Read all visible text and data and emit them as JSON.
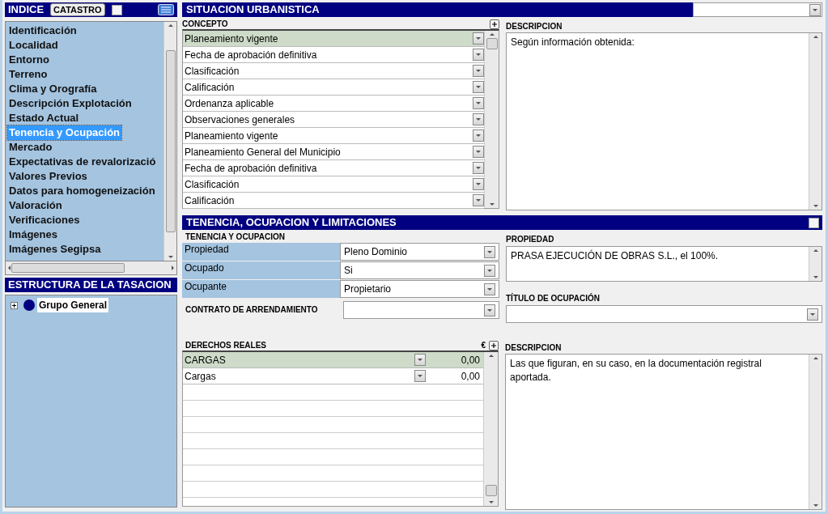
{
  "index": {
    "title": "INDICE",
    "catastro_button": "CATASTRO",
    "catastro_checked": false,
    "items": [
      {
        "label": "Identificación",
        "selected": false
      },
      {
        "label": "Localidad",
        "selected": false
      },
      {
        "label": "Entorno",
        "selected": false
      },
      {
        "label": "Terreno",
        "selected": false
      },
      {
        "label": "Clima y Orografía",
        "selected": false
      },
      {
        "label": "Descripción Explotación",
        "selected": false
      },
      {
        "label": "Estado Actual",
        "selected": false
      },
      {
        "label": "Tenencia y Ocupación",
        "selected": true
      },
      {
        "label": "Mercado",
        "selected": false
      },
      {
        "label": "Expectativas de revalorizació",
        "selected": false
      },
      {
        "label": "Valores Previos",
        "selected": false
      },
      {
        "label": "Datos para homogeneización",
        "selected": false
      },
      {
        "label": "Valoración",
        "selected": false
      },
      {
        "label": "Verificaciones",
        "selected": false
      },
      {
        "label": "Imágenes",
        "selected": false
      },
      {
        "label": "Imágenes Segipsa",
        "selected": false
      }
    ]
  },
  "structure": {
    "title": "ESTRUCTURA DE LA TASACION",
    "tree": [
      {
        "label": "Grupo General",
        "expanded": false,
        "color": "#000080"
      }
    ]
  },
  "urbanistica": {
    "title": "SITUACION URBANISTICA",
    "concept_header": "CONCEPTO",
    "description_header": "DESCRIPCION",
    "description": "Según información obtenida:",
    "concepts": [
      {
        "label": "Planeamiento vigente",
        "selected": true
      },
      {
        "label": "Fecha de aprobación definitiva",
        "selected": false
      },
      {
        "label": "Clasificación",
        "selected": false
      },
      {
        "label": "Calificación",
        "selected": false
      },
      {
        "label": "Ordenanza aplicable",
        "selected": false
      },
      {
        "label": "Observaciones generales",
        "selected": false
      },
      {
        "label": "Planeamiento vigente",
        "selected": false
      },
      {
        "label": "Planeamiento General del Municipio",
        "selected": false
      },
      {
        "label": "Fecha de aprobación definitiva",
        "selected": false
      },
      {
        "label": "Clasificación",
        "selected": false
      },
      {
        "label": "Calificación",
        "selected": false
      }
    ]
  },
  "tenencia": {
    "title": "TENENCIA, OCUPACION Y LIMITACIONES",
    "checked": false,
    "subtitle": "TENENCIA Y OCUPACION",
    "fields": [
      {
        "label": "Propiedad",
        "value": "Pleno Dominio"
      },
      {
        "label": "Ocupado",
        "value": "Si"
      },
      {
        "label": "Ocupante",
        "value": "Propietario"
      }
    ],
    "contract_label": "CONTRATO DE ARRENDAMIENTO",
    "property_header": "PROPIEDAD",
    "property": "PRASA EJECUCIÓN DE OBRAS S.L., el 100%.",
    "occupation_title_header": "TÍTULO DE OCUPACIÓN",
    "rights_header": "DERECHOS REALES",
    "currency": "€",
    "rights": [
      {
        "label": "CARGAS",
        "amount": "0,00",
        "selected": true
      },
      {
        "label": "Cargas",
        "amount": "0,00",
        "selected": false
      }
    ],
    "description_header": "DESCRIPCION",
    "description": "Las que figuran, en su caso, en la documentación registral aportada."
  }
}
